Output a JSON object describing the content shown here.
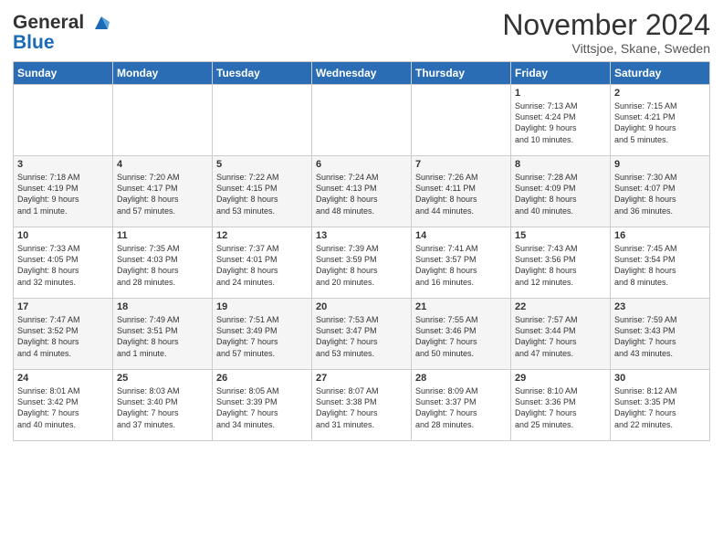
{
  "header": {
    "logo_line1": "General",
    "logo_line2": "Blue",
    "month": "November 2024",
    "location": "Vittsjoe, Skane, Sweden"
  },
  "days_of_week": [
    "Sunday",
    "Monday",
    "Tuesday",
    "Wednesday",
    "Thursday",
    "Friday",
    "Saturday"
  ],
  "weeks": [
    [
      {
        "day": "",
        "info": ""
      },
      {
        "day": "",
        "info": ""
      },
      {
        "day": "",
        "info": ""
      },
      {
        "day": "",
        "info": ""
      },
      {
        "day": "",
        "info": ""
      },
      {
        "day": "1",
        "info": "Sunrise: 7:13 AM\nSunset: 4:24 PM\nDaylight: 9 hours\nand 10 minutes."
      },
      {
        "day": "2",
        "info": "Sunrise: 7:15 AM\nSunset: 4:21 PM\nDaylight: 9 hours\nand 5 minutes."
      }
    ],
    [
      {
        "day": "3",
        "info": "Sunrise: 7:18 AM\nSunset: 4:19 PM\nDaylight: 9 hours\nand 1 minute."
      },
      {
        "day": "4",
        "info": "Sunrise: 7:20 AM\nSunset: 4:17 PM\nDaylight: 8 hours\nand 57 minutes."
      },
      {
        "day": "5",
        "info": "Sunrise: 7:22 AM\nSunset: 4:15 PM\nDaylight: 8 hours\nand 53 minutes."
      },
      {
        "day": "6",
        "info": "Sunrise: 7:24 AM\nSunset: 4:13 PM\nDaylight: 8 hours\nand 48 minutes."
      },
      {
        "day": "7",
        "info": "Sunrise: 7:26 AM\nSunset: 4:11 PM\nDaylight: 8 hours\nand 44 minutes."
      },
      {
        "day": "8",
        "info": "Sunrise: 7:28 AM\nSunset: 4:09 PM\nDaylight: 8 hours\nand 40 minutes."
      },
      {
        "day": "9",
        "info": "Sunrise: 7:30 AM\nSunset: 4:07 PM\nDaylight: 8 hours\nand 36 minutes."
      }
    ],
    [
      {
        "day": "10",
        "info": "Sunrise: 7:33 AM\nSunset: 4:05 PM\nDaylight: 8 hours\nand 32 minutes."
      },
      {
        "day": "11",
        "info": "Sunrise: 7:35 AM\nSunset: 4:03 PM\nDaylight: 8 hours\nand 28 minutes."
      },
      {
        "day": "12",
        "info": "Sunrise: 7:37 AM\nSunset: 4:01 PM\nDaylight: 8 hours\nand 24 minutes."
      },
      {
        "day": "13",
        "info": "Sunrise: 7:39 AM\nSunset: 3:59 PM\nDaylight: 8 hours\nand 20 minutes."
      },
      {
        "day": "14",
        "info": "Sunrise: 7:41 AM\nSunset: 3:57 PM\nDaylight: 8 hours\nand 16 minutes."
      },
      {
        "day": "15",
        "info": "Sunrise: 7:43 AM\nSunset: 3:56 PM\nDaylight: 8 hours\nand 12 minutes."
      },
      {
        "day": "16",
        "info": "Sunrise: 7:45 AM\nSunset: 3:54 PM\nDaylight: 8 hours\nand 8 minutes."
      }
    ],
    [
      {
        "day": "17",
        "info": "Sunrise: 7:47 AM\nSunset: 3:52 PM\nDaylight: 8 hours\nand 4 minutes."
      },
      {
        "day": "18",
        "info": "Sunrise: 7:49 AM\nSunset: 3:51 PM\nDaylight: 8 hours\nand 1 minute."
      },
      {
        "day": "19",
        "info": "Sunrise: 7:51 AM\nSunset: 3:49 PM\nDaylight: 7 hours\nand 57 minutes."
      },
      {
        "day": "20",
        "info": "Sunrise: 7:53 AM\nSunset: 3:47 PM\nDaylight: 7 hours\nand 53 minutes."
      },
      {
        "day": "21",
        "info": "Sunrise: 7:55 AM\nSunset: 3:46 PM\nDaylight: 7 hours\nand 50 minutes."
      },
      {
        "day": "22",
        "info": "Sunrise: 7:57 AM\nSunset: 3:44 PM\nDaylight: 7 hours\nand 47 minutes."
      },
      {
        "day": "23",
        "info": "Sunrise: 7:59 AM\nSunset: 3:43 PM\nDaylight: 7 hours\nand 43 minutes."
      }
    ],
    [
      {
        "day": "24",
        "info": "Sunrise: 8:01 AM\nSunset: 3:42 PM\nDaylight: 7 hours\nand 40 minutes."
      },
      {
        "day": "25",
        "info": "Sunrise: 8:03 AM\nSunset: 3:40 PM\nDaylight: 7 hours\nand 37 minutes."
      },
      {
        "day": "26",
        "info": "Sunrise: 8:05 AM\nSunset: 3:39 PM\nDaylight: 7 hours\nand 34 minutes."
      },
      {
        "day": "27",
        "info": "Sunrise: 8:07 AM\nSunset: 3:38 PM\nDaylight: 7 hours\nand 31 minutes."
      },
      {
        "day": "28",
        "info": "Sunrise: 8:09 AM\nSunset: 3:37 PM\nDaylight: 7 hours\nand 28 minutes."
      },
      {
        "day": "29",
        "info": "Sunrise: 8:10 AM\nSunset: 3:36 PM\nDaylight: 7 hours\nand 25 minutes."
      },
      {
        "day": "30",
        "info": "Sunrise: 8:12 AM\nSunset: 3:35 PM\nDaylight: 7 hours\nand 22 minutes."
      }
    ]
  ]
}
